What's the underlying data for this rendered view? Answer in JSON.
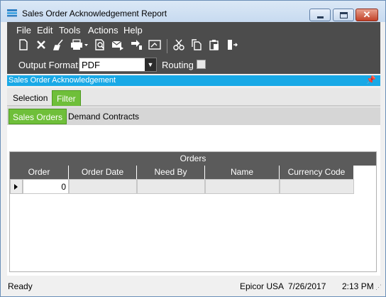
{
  "window": {
    "title": "Sales Order Acknowledgement Report",
    "controls": {
      "minimize": "minimize",
      "maximize": "maximize",
      "close": "✕"
    }
  },
  "menu": [
    "File",
    "Edit",
    "Tools",
    "Actions",
    "Help"
  ],
  "toolbar": {
    "icons": [
      "new-icon",
      "delete-icon",
      "clear-icon",
      "print-icon",
      "print-preview-icon",
      "send-email-icon",
      "generate-icon",
      "schedule-icon",
      "cut-icon",
      "copy-icon",
      "paste-icon",
      "exit-icon"
    ]
  },
  "options": {
    "output_format_label": "Output Format:",
    "output_format_value": "PDF",
    "routing_label": "Routing",
    "routing_checked": false
  },
  "panel": {
    "title": "Sales Order Acknowledgement"
  },
  "tabs": [
    {
      "label": "Selection",
      "active": false
    },
    {
      "label": "Filter",
      "active": true
    }
  ],
  "subtabs": [
    {
      "label": "Sales Orders",
      "active": true
    },
    {
      "label": "Demand Contracts",
      "active": false
    }
  ],
  "grid": {
    "group_header": "Orders",
    "columns": [
      "Order",
      "Order Date",
      "Need By",
      "Name",
      "Currency Code"
    ],
    "rows": [
      {
        "order": "0",
        "order_date": "",
        "need_by": "",
        "name": "",
        "currency_code": ""
      }
    ]
  },
  "status": {
    "left": "Ready",
    "company": "Epicor USA",
    "date": "7/26/2017",
    "time": "2:13 PM"
  },
  "colors": {
    "accent_green": "#6fbf3a",
    "panel_blue": "#19a9e6",
    "command_dark": "#4c4c4c"
  }
}
